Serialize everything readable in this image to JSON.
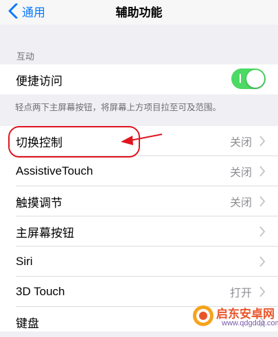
{
  "navbar": {
    "back_label": "通用",
    "title": "辅助功能"
  },
  "section_interaction": {
    "header": "互动",
    "reachability": {
      "label": "便捷访问",
      "enabled": true
    },
    "footer": "轻点两下主屏幕按钮，将屏幕上方项目拉至可及范围。"
  },
  "list": [
    {
      "label": "切换控制",
      "value": "关闭"
    },
    {
      "label": "AssistiveTouch",
      "value": "关闭"
    },
    {
      "label": "触摸调节",
      "value": "关闭"
    },
    {
      "label": "主屏幕按钮",
      "value": ""
    },
    {
      "label": "Siri",
      "value": ""
    },
    {
      "label": "3D Touch",
      "value": "打开"
    },
    {
      "label": "键盘",
      "value": ""
    }
  ],
  "watermark": {
    "brand": "启东安卓网",
    "url": "www.qdgddq.com"
  },
  "colors": {
    "accent": "#0a7aff",
    "toggle_on": "#4cd964",
    "annotation_red": "#e0141e",
    "watermark_orange": "#e8552b"
  }
}
